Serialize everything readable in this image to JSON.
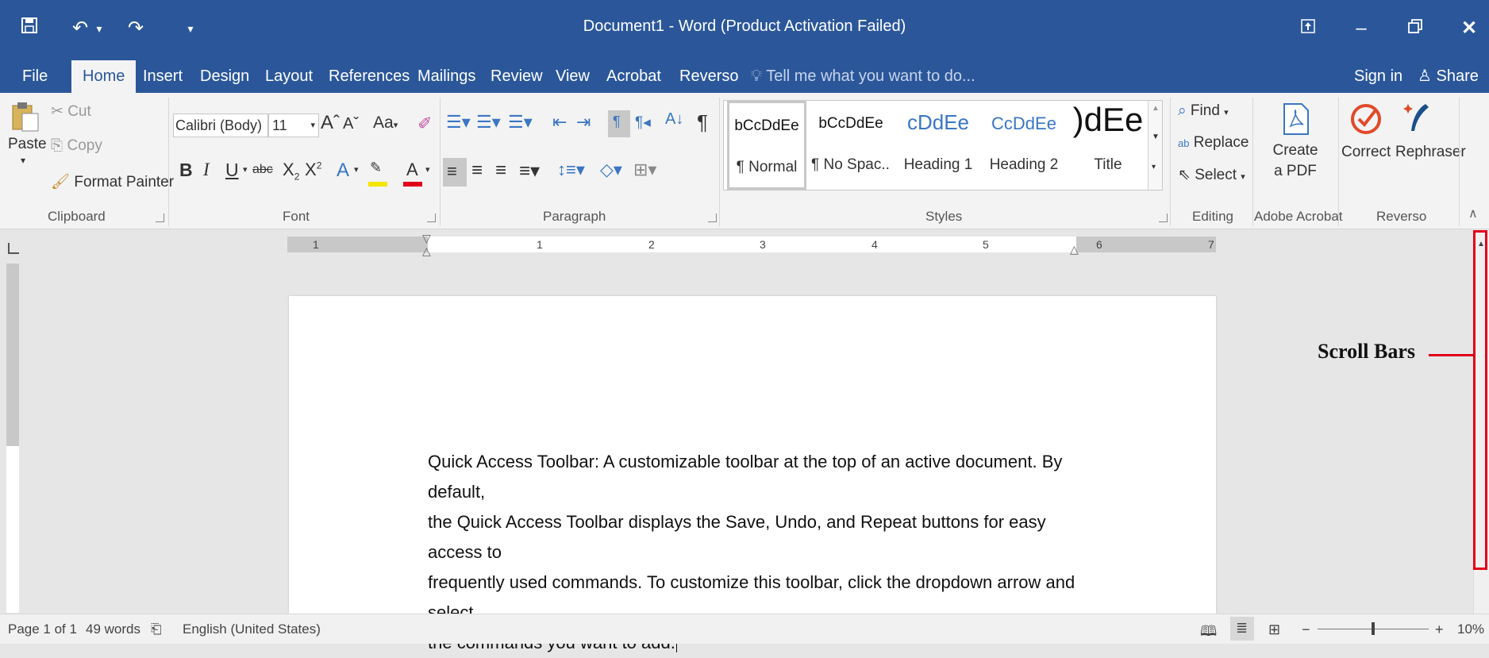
{
  "window": {
    "title": "Document1 - Word (Product Activation Failed)"
  },
  "quick_access": {
    "save_icon": "save-icon",
    "undo_icon": "undo-icon",
    "repeat_icon": "repeat-icon",
    "customize_icon": "customize-qat-icon"
  },
  "tabs": [
    {
      "label": "File"
    },
    {
      "label": "Home"
    },
    {
      "label": "Insert"
    },
    {
      "label": "Design"
    },
    {
      "label": "Layout"
    },
    {
      "label": "References"
    },
    {
      "label": "Mailings"
    },
    {
      "label": "Review"
    },
    {
      "label": "View"
    },
    {
      "label": "Acrobat"
    },
    {
      "label": "Reverso"
    }
  ],
  "active_tab": "Home",
  "tell_me": "Tell me what you want to do...",
  "account": {
    "sign_in": "Sign in",
    "share": "Share"
  },
  "clipboard": {
    "paste": "Paste",
    "cut": "Cut",
    "copy": "Copy",
    "format_painter": "Format Painter",
    "group_label": "Clipboard"
  },
  "font": {
    "font_name": "Calibri (Body)",
    "font_size": "11",
    "change_case": "Aa",
    "group_label": "Font"
  },
  "paragraph": {
    "group_label": "Paragraph"
  },
  "styles": {
    "items": [
      {
        "preview": "bCcDdEe",
        "label": "¶ Normal"
      },
      {
        "preview": "bCcDdEe",
        "label": "¶ No Spac..."
      },
      {
        "preview": "cDdEe",
        "label": "Heading 1"
      },
      {
        "preview": "CcDdEe",
        "label": "Heading 2"
      },
      {
        "preview": ")dEe",
        "label": "Title"
      }
    ],
    "group_label": "Styles"
  },
  "editing": {
    "find": "Find",
    "replace": "Replace",
    "select": "Select",
    "group_label": "Editing"
  },
  "adobe": {
    "create_pdf_line1": "Create",
    "create_pdf_line2": "a PDF",
    "group_label": "Adobe Acrobat"
  },
  "reverso": {
    "correct": "Correct",
    "rephraser": "Rephraser",
    "group_label": "Reverso"
  },
  "ruler": {
    "labels": [
      "1",
      "1",
      "2",
      "3",
      "4",
      "5",
      "6",
      "7"
    ]
  },
  "document": {
    "lines": [
      "Quick Access Toolbar: A customizable toolbar at the top of an active document. By default,",
      "the Quick Access Toolbar displays the Save, Undo, and Repeat buttons for easy access to",
      "frequently used commands. To customize this toolbar, click the dropdown arrow and select",
      "the commands you want to add."
    ]
  },
  "annotation": {
    "label": "Scroll Bars",
    "color": "#e0001b"
  },
  "status": {
    "page": "Page 1 of 1",
    "words": "49 words",
    "language": "English (United States)",
    "zoom": "10%"
  },
  "colors": {
    "ribbon_blue": "#2b579a",
    "ribbon_bg": "#f3f3f3",
    "workspace": "#e6e6e6"
  }
}
